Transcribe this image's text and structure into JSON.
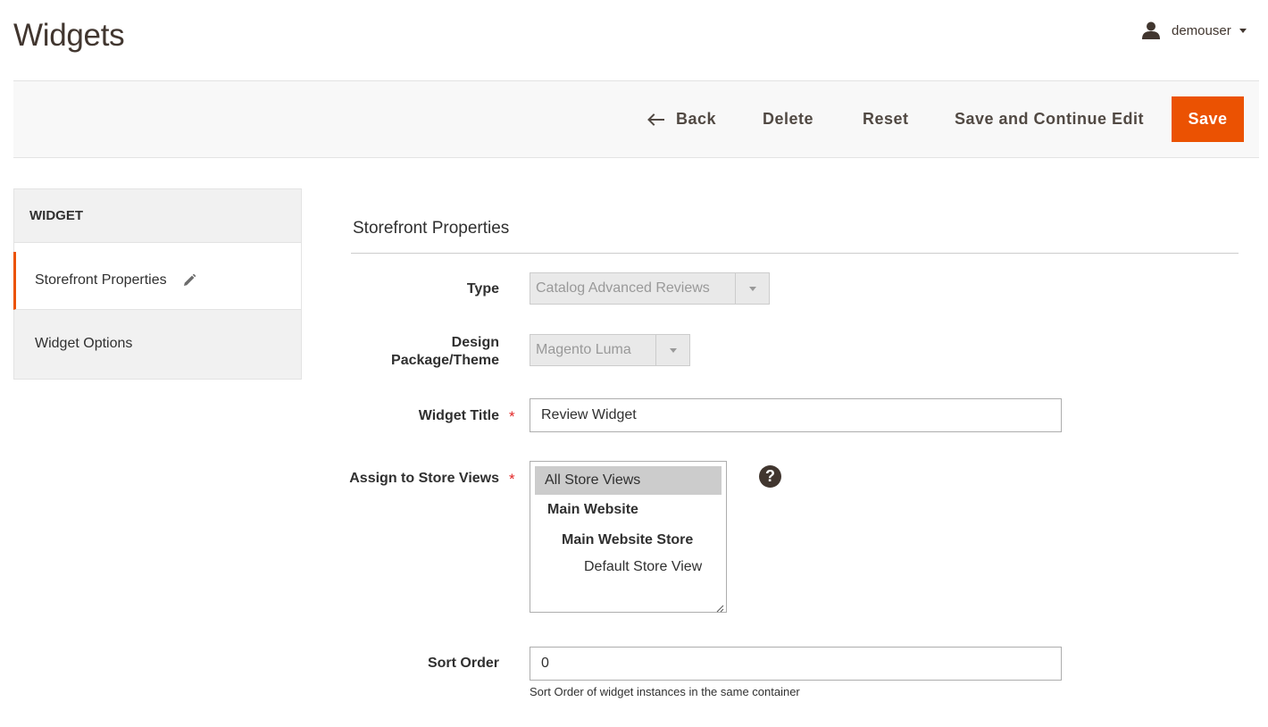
{
  "header": {
    "title": "Widgets"
  },
  "user": {
    "name": "demouser"
  },
  "actions": {
    "back": "Back",
    "delete": "Delete",
    "reset": "Reset",
    "save_continue": "Save and Continue Edit",
    "save": "Save"
  },
  "sidebar": {
    "title": "WIDGET",
    "items": [
      {
        "label": "Storefront Properties",
        "active": true
      },
      {
        "label": "Widget Options",
        "active": false
      }
    ]
  },
  "section": {
    "title": "Storefront Properties"
  },
  "form": {
    "type": {
      "label": "Type",
      "value": "Catalog Advanced Reviews"
    },
    "design": {
      "label_line1": "Design",
      "label_line2": "Package/Theme",
      "value": "Magento Luma"
    },
    "widget_title": {
      "label": "Widget Title",
      "value": "Review Widget",
      "required_mark": "*"
    },
    "store_views": {
      "label": "Assign to Store Views",
      "required_mark": "*",
      "options": [
        "All Store Views",
        "Main Website",
        "Main Website Store",
        "Default Store View"
      ],
      "selected": "All Store Views",
      "help": "?"
    },
    "sort_order": {
      "label": "Sort Order",
      "value": "0",
      "note": "Sort Order of widget instances in the same container"
    }
  },
  "colors": {
    "accent": "#eb5202",
    "required": "#e22626",
    "text": "#303030"
  },
  "icons": {
    "user": "user-icon",
    "back": "arrow-left-icon",
    "edit": "pencil-icon",
    "help": "question-circle-icon"
  }
}
